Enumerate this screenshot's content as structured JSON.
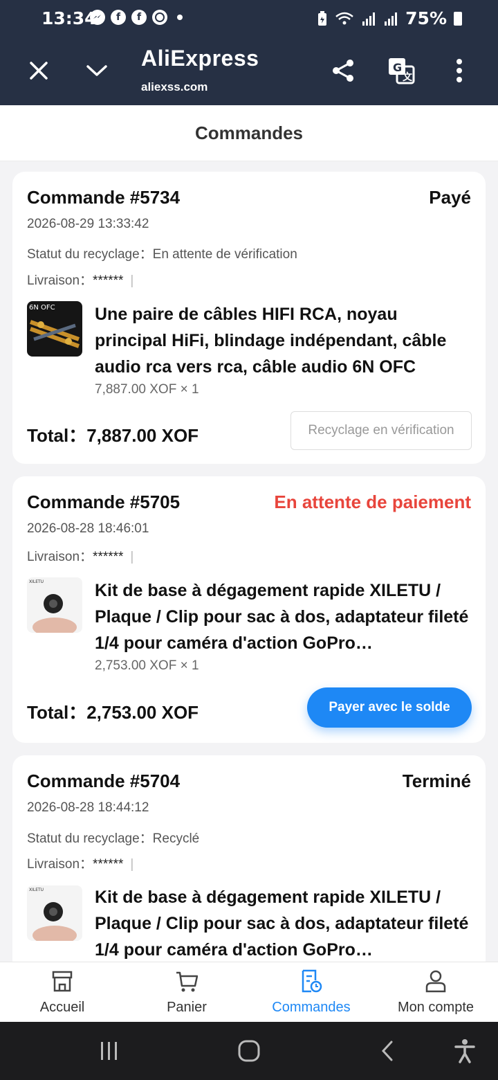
{
  "status_bar": {
    "time": "13:34",
    "battery": "75%",
    "left_icons": [
      "messenger-icon",
      "facebook-icon",
      "facebook-icon",
      "whatsapp-icon",
      "dot-icon"
    ],
    "right_icons": [
      "battery-saver-icon",
      "wifi-icon",
      "signal-icon",
      "signal-icon",
      "battery-icon"
    ]
  },
  "browser": {
    "title": "AliExpress",
    "url": "aliexss.com"
  },
  "page": {
    "title": "Commandes"
  },
  "orders": [
    {
      "number": "Commande #5734",
      "status": "Payé",
      "date": "2026-08-29 13:33:42",
      "recycle_label": "Statut du recyclage：",
      "recycle_value": "En attente de vérification",
      "delivery_label": "Livraison：",
      "delivery_value": "******",
      "product_title": "Une paire de câbles HIFI RCA, noyau principal HiFi, blindage indépendant, câble audio rca vers rca, câble audio 6N OFC",
      "thumb_text": "6N OFC",
      "price": "7,887.00 XOF × 1",
      "total_label": "Total：",
      "total_value": "7,887.00 XOF",
      "action": "Recyclage en vérification"
    },
    {
      "number": "Commande #5705",
      "status": "En attente de paiement",
      "date": "2026-08-28 18:46:01",
      "delivery_label": "Livraison：",
      "delivery_value": "******",
      "product_title": "Kit de base à dégagement rapide XILETU / Plaque / Clip pour sac à dos, adaptateur fileté 1/4 pour caméra d'action GoPro…",
      "thumb_text": "XILETU",
      "price": "2,753.00 XOF × 1",
      "total_label": "Total：",
      "total_value": "2,753.00 XOF",
      "action": "Payer avec le solde"
    },
    {
      "number": "Commande #5704",
      "status": "Terminé",
      "date": "2026-08-28 18:44:12",
      "recycle_label": "Statut du recyclage：",
      "recycle_value": "Recyclé",
      "delivery_label": "Livraison：",
      "delivery_value": "******",
      "product_title": "Kit de base à dégagement rapide XILETU / Plaque / Clip pour sac à dos, adaptateur fileté 1/4 pour caméra d'action GoPro…",
      "thumb_text": "XILETU"
    }
  ],
  "bottom_nav": [
    {
      "label": "Accueil",
      "icon": "store-icon"
    },
    {
      "label": "Panier",
      "icon": "cart-icon"
    },
    {
      "label": "Commandes",
      "icon": "orders-icon",
      "active": true
    },
    {
      "label": "Mon compte",
      "icon": "account-icon"
    }
  ],
  "colors": {
    "accent": "#1e88f5",
    "alert": "#e8453c",
    "header_bg": "#263044"
  }
}
